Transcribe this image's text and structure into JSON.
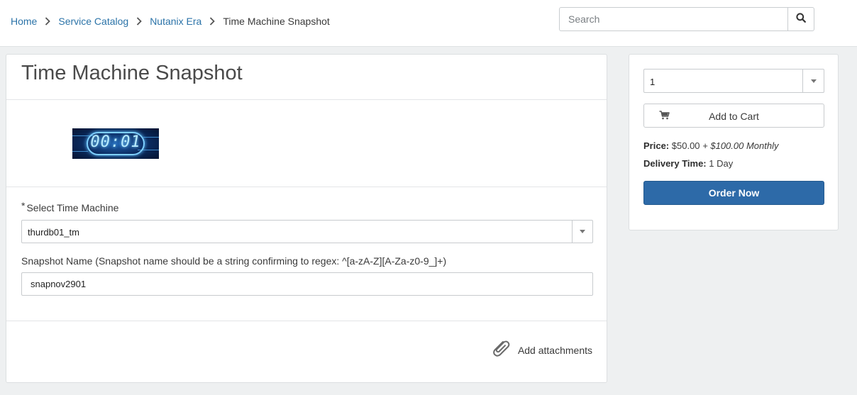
{
  "breadcrumb": {
    "items": [
      "Home",
      "Service Catalog",
      "Nutanix Era"
    ],
    "current": "Time Machine Snapshot"
  },
  "search": {
    "placeholder": "Search",
    "icon": "search-icon"
  },
  "item": {
    "title": "Time Machine Snapshot",
    "banner_digits": "00:01"
  },
  "form": {
    "time_machine": {
      "required_mark": "*",
      "label": "Select Time Machine",
      "value": "thurdb01_tm"
    },
    "snapshot": {
      "label": "Snapshot Name (Snapshot name should be a string confirming to regex: ^[a-zA-Z][A-Za-z0-9_]+)",
      "value": "snapnov2901"
    },
    "attachments_label": "Add attachments"
  },
  "sidebar": {
    "quantity": "1",
    "add_to_cart": "Add to Cart",
    "price_label": "Price:",
    "price_value": "$50.00",
    "price_recurring": "+ $100.00 Monthly",
    "delivery_label": "Delivery Time:",
    "delivery_value": "1 Day",
    "order_now": "Order Now"
  },
  "colors": {
    "link": "#2b73a8",
    "primary_button": "#2d6aa8",
    "background": "#eef0f1"
  }
}
